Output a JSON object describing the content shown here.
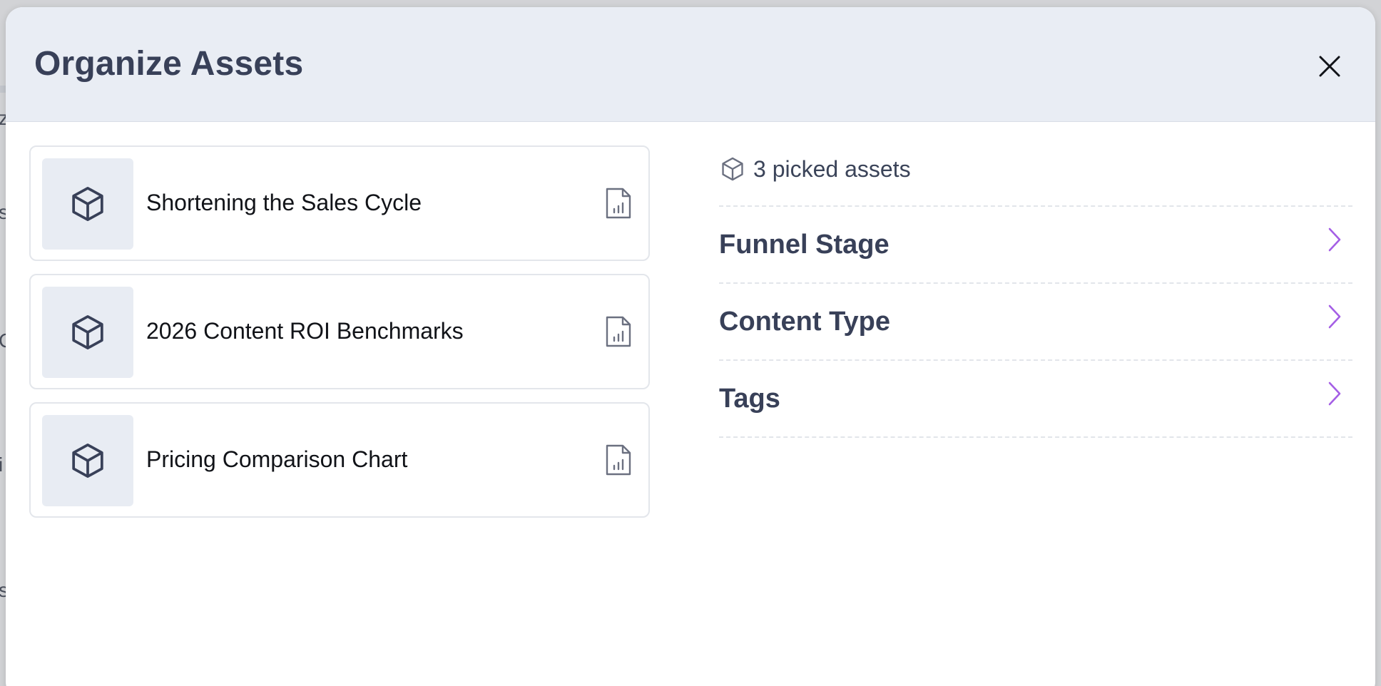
{
  "background_fragments": [
    "z",
    "s",
    "C",
    "i",
    "s"
  ],
  "modal": {
    "title": "Organize Assets",
    "close_icon": "close-icon"
  },
  "assets": [
    {
      "name": "Shortening the Sales Cycle",
      "thumb_icon": "cube-icon",
      "type_icon": "document-chart-icon"
    },
    {
      "name": "2026 Content ROI Benchmarks",
      "thumb_icon": "cube-icon",
      "type_icon": "document-chart-icon"
    },
    {
      "name": "Pricing Comparison Chart",
      "thumb_icon": "cube-icon",
      "type_icon": "document-chart-icon"
    }
  ],
  "summary": {
    "picked_label": "3 picked assets",
    "icon": "cube-icon"
  },
  "categories": [
    {
      "label": "Funnel Stage",
      "icon": "chevron-right-icon"
    },
    {
      "label": "Content Type",
      "icon": "chevron-right-icon"
    },
    {
      "label": "Tags",
      "icon": "chevron-right-icon"
    }
  ],
  "colors": {
    "header_bg": "#e9edf4",
    "title_text": "#384058",
    "chevron_accent": "#a45ee5",
    "thumb_bg": "#e8ecf3",
    "icon_stroke": "#384058"
  }
}
